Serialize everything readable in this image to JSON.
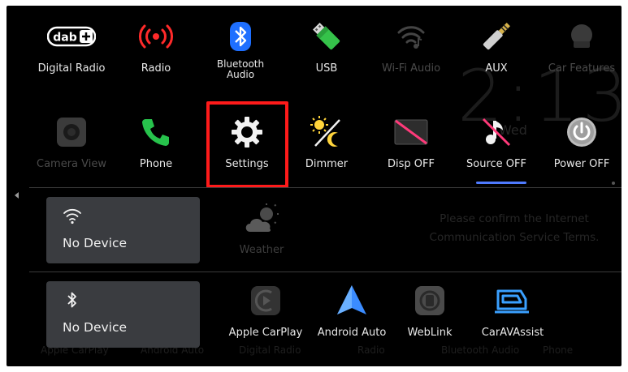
{
  "background": {
    "clock": "2:13",
    "date": "Wed",
    "notice": "Please confirm the Internet Communication Service Terms.",
    "bottom_row": [
      "Apple CarPlay",
      "Android Auto",
      "Digital Radio",
      "Radio",
      "Bluetooth Audio",
      "Phone"
    ]
  },
  "apps_row1": [
    {
      "label": "Digital Radio",
      "icon": "dab-icon"
    },
    {
      "label": "Radio",
      "icon": "radio-waves-icon"
    },
    {
      "label": "Bluetooth Audio",
      "icon": "bluetooth-icon"
    },
    {
      "label": "USB",
      "icon": "usb-icon"
    },
    {
      "label": "Wi-Fi Audio",
      "icon": "wifi-audio-icon",
      "dim": true
    },
    {
      "label": "AUX",
      "icon": "aux-jack-icon"
    },
    {
      "label": "Car Features",
      "icon": "car-features-icon",
      "dim": true
    }
  ],
  "apps_row2": [
    {
      "label": "Camera View",
      "icon": "camera-icon",
      "dim": true
    },
    {
      "label": "Phone",
      "icon": "phone-icon"
    },
    {
      "label": "Settings",
      "icon": "gear-icon"
    },
    {
      "label": "Dimmer",
      "icon": "dimmer-icon"
    },
    {
      "label": "Disp OFF",
      "icon": "display-off-icon"
    },
    {
      "label": "Source OFF",
      "icon": "source-off-icon"
    },
    {
      "label": "Power OFF",
      "icon": "power-icon"
    }
  ],
  "wifi_card": {
    "label": "No Device",
    "icon": "wifi-icon"
  },
  "bt_card": {
    "label": "No Device",
    "icon": "bluetooth-icon"
  },
  "weather": {
    "label": "Weather",
    "icon": "weather-icon"
  },
  "connect_apps": [
    {
      "label": "Apple CarPlay",
      "icon": "carplay-icon"
    },
    {
      "label": "Android Auto",
      "icon": "android-auto-icon"
    },
    {
      "label": "WebLink",
      "icon": "weblink-icon"
    },
    {
      "label": "CarAVAssist",
      "icon": "caravassist-icon"
    }
  ],
  "colors": {
    "highlight": "#ff1a1a",
    "bluetooth": "#1e6fff",
    "radio": "#ff2a2a",
    "phone": "#27c24c",
    "indicator": "#4f7bff",
    "android_auto": "#3b8cff",
    "caravassist": "#3aa0ff"
  }
}
